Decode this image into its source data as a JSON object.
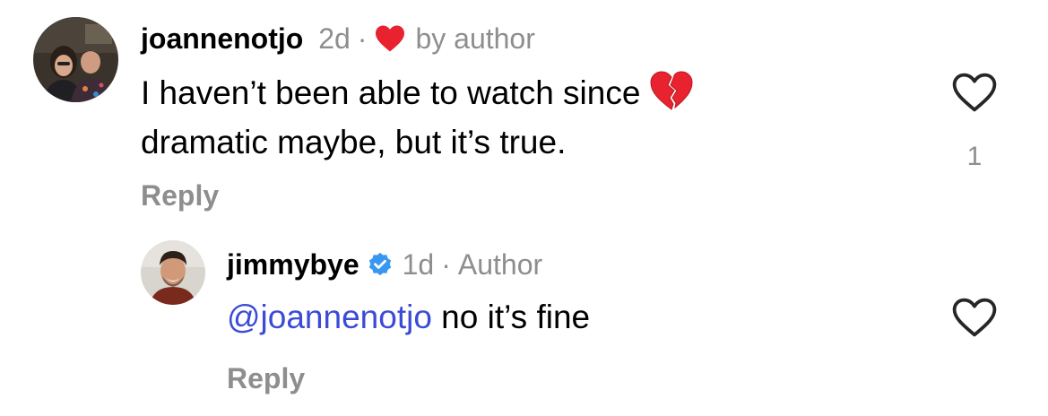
{
  "comments": [
    {
      "username": "joannenotjo",
      "age": "2d",
      "separator": "·",
      "liked_by_author_label": "by author",
      "text_line1": "I haven’t been able to watch since",
      "text_line2": "dramatic maybe, but it’s true.",
      "emoji": "broken-heart",
      "reply_label": "Reply",
      "like_count": "1",
      "icons": {
        "liked_by_author": "red-heart-icon",
        "like": "heart-outline-icon"
      }
    },
    {
      "username": "jimmybye",
      "verified": true,
      "age": "1d",
      "separator": "·",
      "author_label": "Author",
      "mention": "@joannenotjo",
      "text": " no it’s fine",
      "reply_label": "Reply",
      "icons": {
        "verified": "verified-badge-icon",
        "like": "heart-outline-icon"
      }
    }
  ],
  "colors": {
    "secondary_text": "#8e8e8e",
    "mention": "#3b4bd6",
    "heart": "#e8222e",
    "verified": "#3897f0"
  }
}
